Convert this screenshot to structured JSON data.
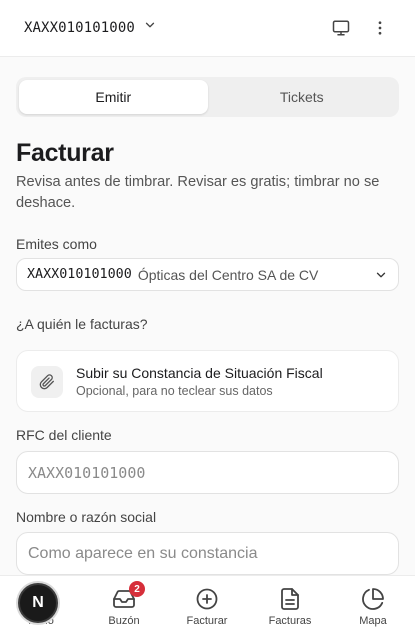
{
  "topbar": {
    "rfc": "XAXX010101000",
    "icons": [
      "chevron-down-icon",
      "monitor-icon",
      "more-vertical-icon"
    ]
  },
  "tabs": [
    {
      "label": "Emitir",
      "active": true
    },
    {
      "label": "Tickets",
      "active": false
    }
  ],
  "page": {
    "title": "Facturar",
    "subtitle": "Revisa antes de timbrar. Revisar es gratis; timbrar no se deshace."
  },
  "issuer": {
    "label": "Emites como",
    "rfc": "XAXX010101000",
    "name": "Ópticas del Centro SA de CV"
  },
  "recipient": {
    "label": "¿A quién le facturas?",
    "upload_title": "Subir su Constancia de Situación Fiscal",
    "upload_hint": "Opcional, para no teclear sus datos",
    "rfc_label": "RFC del cliente",
    "rfc_placeholder": "XAXX010101000",
    "name_label": "Nombre o razón social",
    "name_placeholder": "Como aparece en su constancia"
  },
  "nav": {
    "items": [
      {
        "label": "Inicio",
        "icon": "home-icon"
      },
      {
        "label": "Buzón",
        "icon": "inbox-icon",
        "badge": "2"
      },
      {
        "label": "Facturar",
        "icon": "plus-circle-icon"
      },
      {
        "label": "Facturas",
        "icon": "file-text-icon"
      },
      {
        "label": "Mapa",
        "icon": "pie-chart-icon"
      }
    ]
  },
  "fab": {
    "letter": "N"
  },
  "colors": {
    "badge": "#d62f3a",
    "fab": "#1a1a1a",
    "accent": "#1c1c1e"
  }
}
